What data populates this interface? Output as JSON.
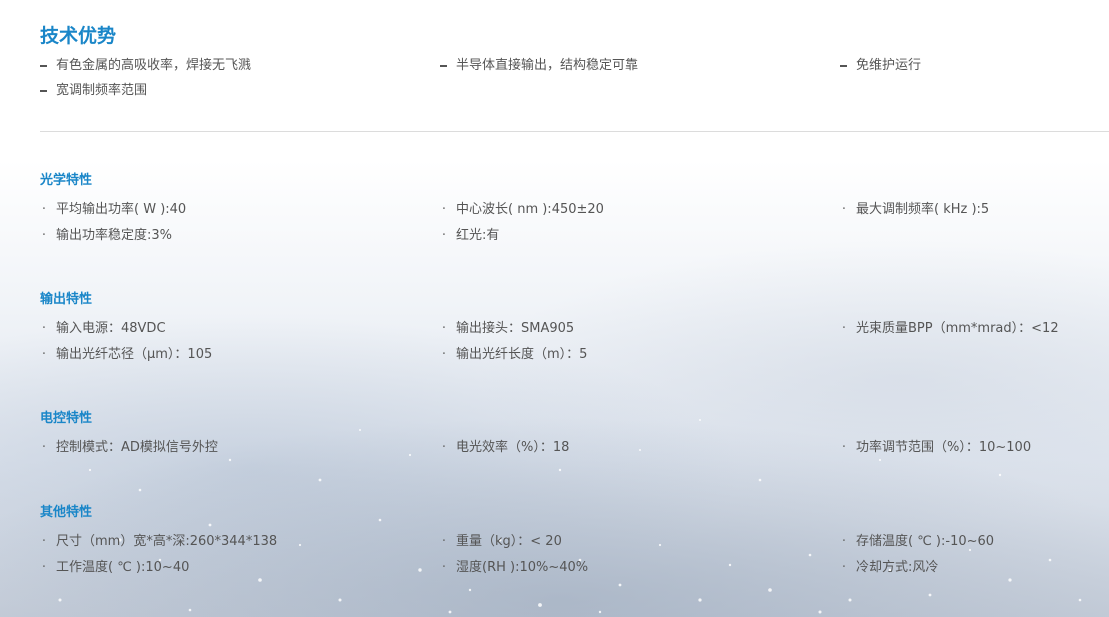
{
  "advantages": {
    "title": "技术优势",
    "items": [
      "有色金属的高吸收率，焊接无飞溅",
      "半导体直接输出，结构稳定可靠",
      "免维护运行",
      "宽调制频率范围"
    ]
  },
  "sections": [
    {
      "title": "光学特性",
      "items": [
        "平均输出功率( W ):40",
        "中心波长( nm ):450±20",
        "最大调制频率( kHz ):5",
        "输出功率稳定度:3%",
        "红光:有"
      ]
    },
    {
      "title": "输出特性",
      "items": [
        "输入电源：48VDC",
        "输出接头：SMA905",
        "光束质量BPP（mm*mrad）：<12",
        "输出光纤芯径（μm）：105",
        "输出光纤长度（m）：5"
      ]
    },
    {
      "title": "电控特性",
      "items": [
        "控制模式：AD模拟信号外控",
        "电光效率（%）：18",
        "功率调节范围（%）：10~100"
      ]
    },
    {
      "title": "其他特性",
      "items": [
        "尺寸（mm）宽*高*深:260*344*138",
        "重量（kg）：< 20",
        "存储温度( ℃ ):-10~60",
        "工作温度( ℃ ):10~40",
        "湿度(RH ):10%~40%",
        "冷却方式:风冷"
      ]
    }
  ],
  "theme": {
    "accent": "#1a86c8",
    "text": "#555555",
    "divider": "#dcdcdc"
  }
}
